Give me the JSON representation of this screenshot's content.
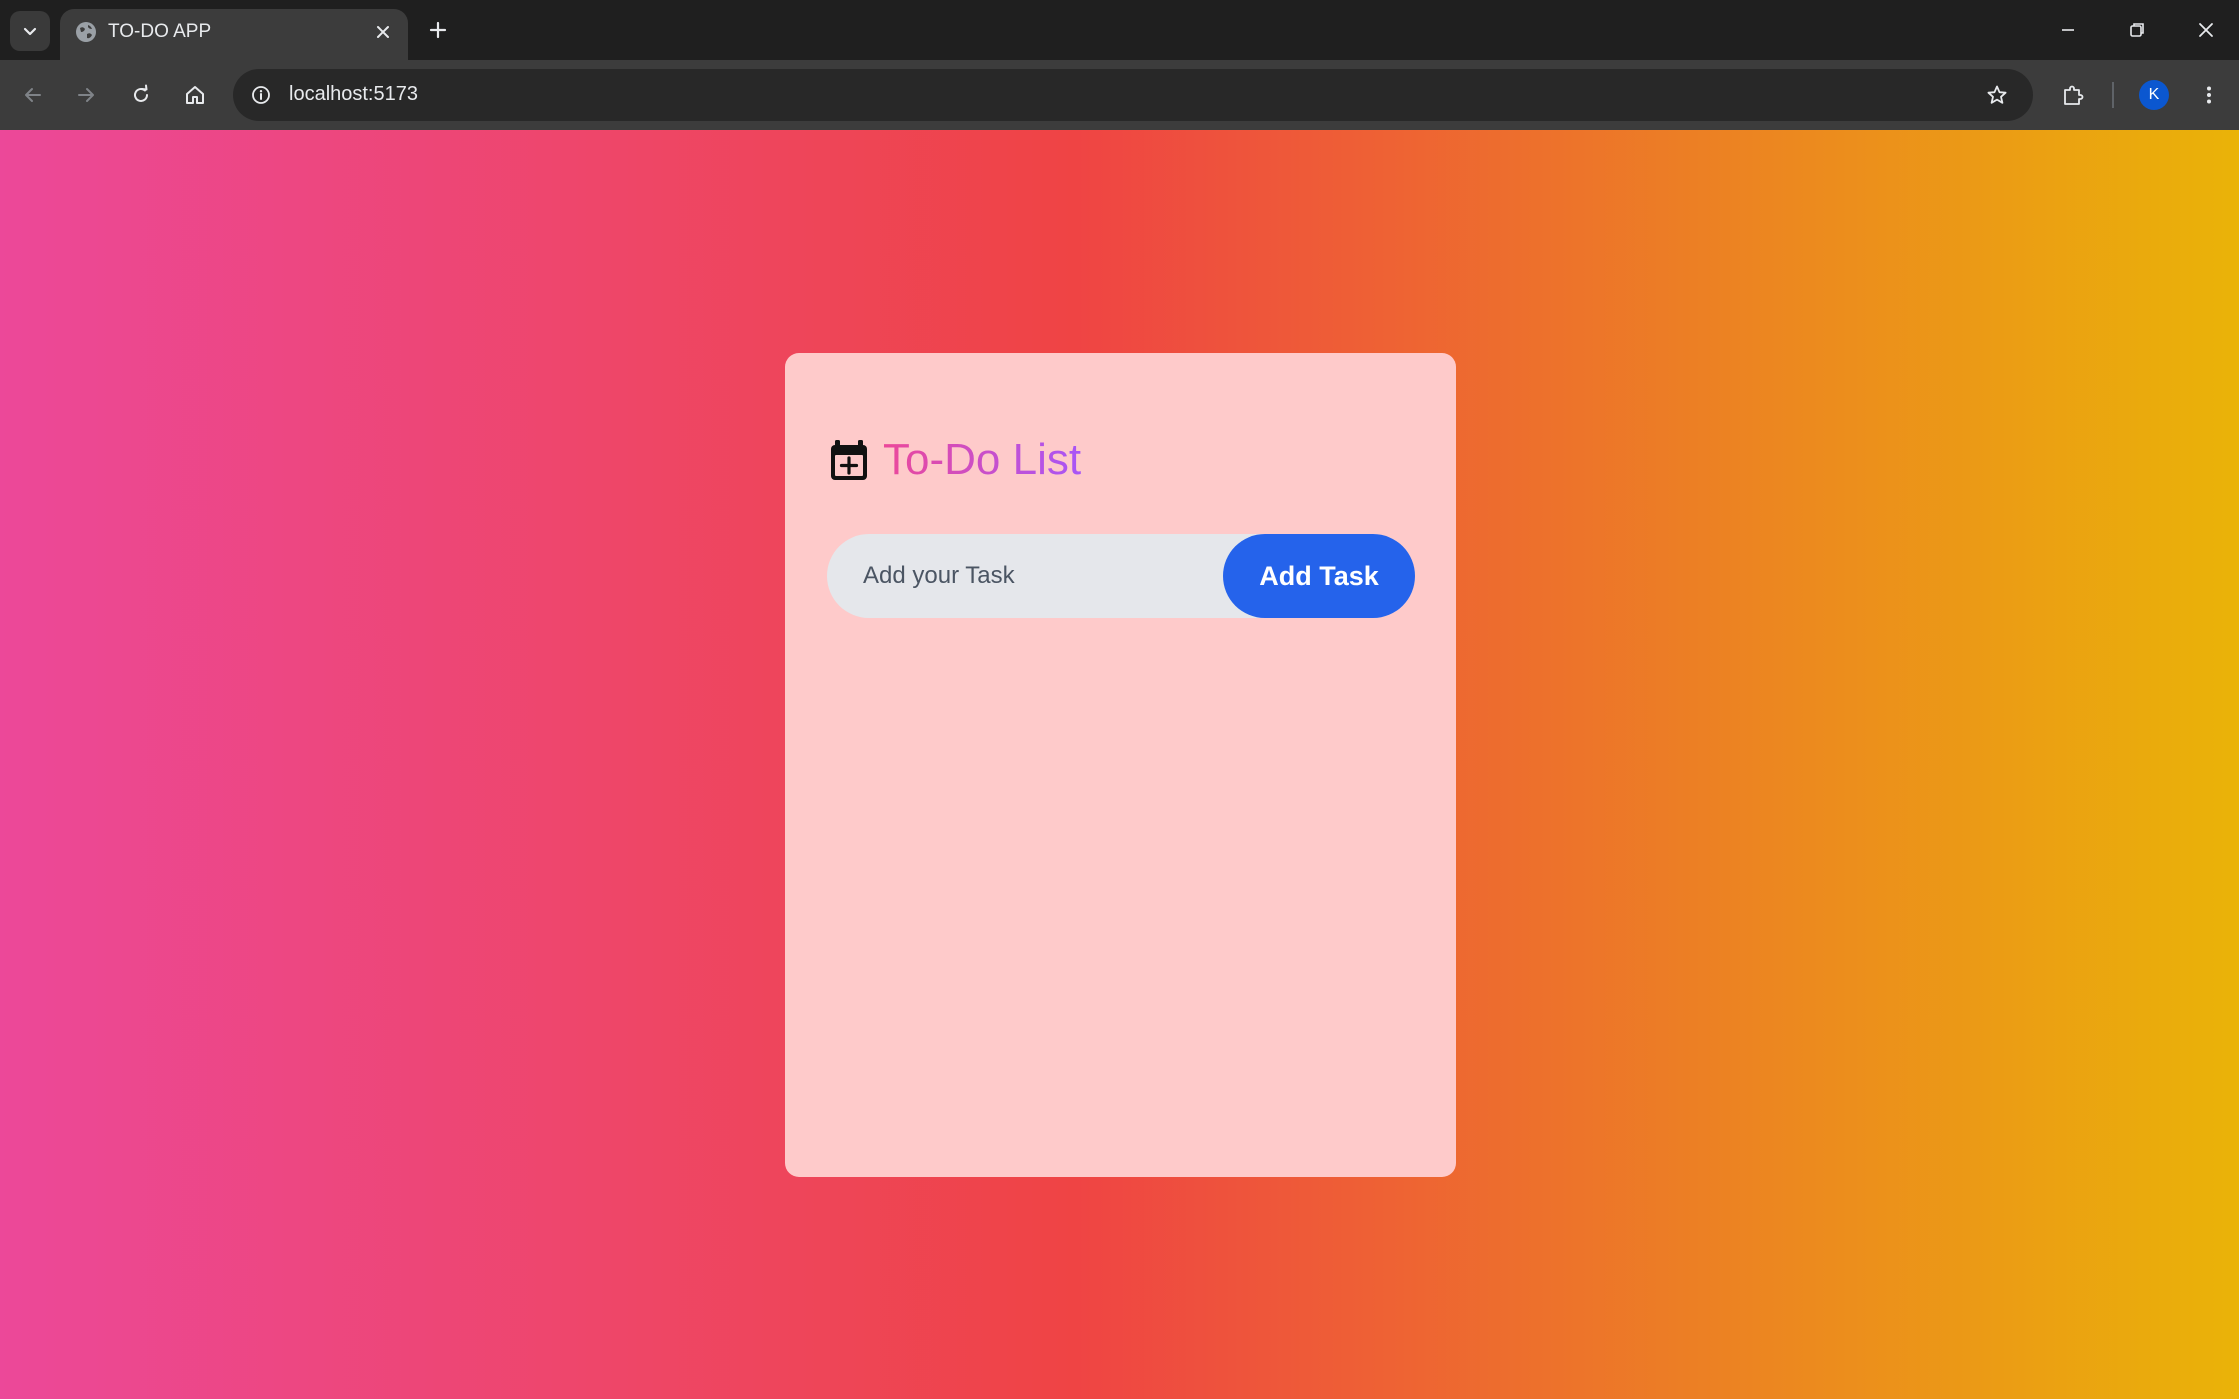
{
  "browser": {
    "tab_title": "TO-DO APP",
    "url": "localhost:5173",
    "profile_initial": "K"
  },
  "app": {
    "title": "To-Do List",
    "input_placeholder": "Add your Task",
    "input_value": "",
    "add_button_label": "Add Task",
    "tasks": []
  },
  "colors": {
    "gradient_start": "#ec4899",
    "gradient_mid": "#ef4444",
    "gradient_end": "#eab308",
    "card_bg": "#fecaca",
    "button_bg": "#2563eb",
    "title_gradient_start": "#ec4899",
    "title_gradient_end": "#a855f7"
  },
  "icons": {
    "tab_search": "chevron-down-icon",
    "favicon": "globe-icon",
    "tab_close": "close-icon",
    "new_tab": "plus-icon",
    "back": "arrow-left-icon",
    "forward": "arrow-right-icon",
    "reload": "reload-icon",
    "home": "home-icon",
    "site_info": "info-icon",
    "bookmark": "star-icon",
    "extensions": "puzzle-icon",
    "menu": "kebab-menu-icon",
    "heading": "calendar-plus-icon"
  }
}
